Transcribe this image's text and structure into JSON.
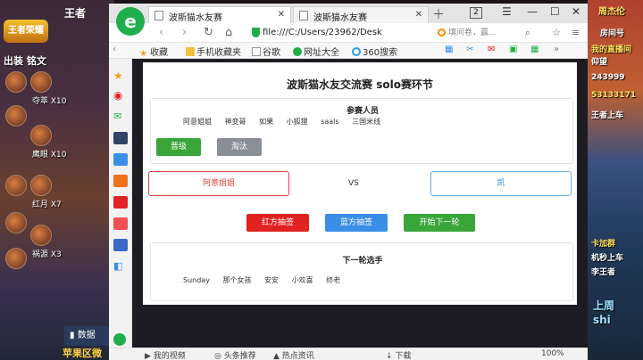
{
  "stream": {
    "logo": "王者",
    "hero_logo": "王者荣耀",
    "section_left": "出装  铭文",
    "skills": [
      {
        "label": "夺萃 X10"
      },
      {
        "label": "鹰眼 X10"
      },
      {
        "label": "红月 X7"
      },
      {
        "label": "祸源 X3"
      }
    ],
    "stats_label": "数据",
    "bottom_left_text": "苹果区微",
    "right_ads": [
      "周杰伦",
      "房间号",
      "我的直播间",
      "仰望",
      "243999",
      "53133171",
      "王者上车",
      "卡加群",
      "机秒上车",
      "李王者",
      "上周",
      "shi"
    ],
    "accent_green": "#1fae4b"
  },
  "browser": {
    "tabs": [
      {
        "label": "波斯猫水友赛"
      },
      {
        "label": "波斯猫水友赛"
      }
    ],
    "tab_count": "2",
    "url": "file:///C:/Users/23962/Desk",
    "search_placeholder": "填问卷，赢...",
    "bookmarks": [
      {
        "label": "收藏"
      },
      {
        "label": "手机收藏夹"
      },
      {
        "label": "谷歌"
      },
      {
        "label": "网址大全"
      },
      {
        "label": "360搜索"
      }
    ],
    "status": [
      {
        "label": "我的视频"
      },
      {
        "label": "头条推荐"
      },
      {
        "label": "热点资讯"
      },
      {
        "label": "下载"
      },
      {
        "label": "100%"
      }
    ]
  },
  "page": {
    "title": "波斯猫水友交流赛 solo赛环节",
    "participants_title": "参赛人员",
    "participants": [
      "阿意姐姐",
      "神变哥",
      "如果",
      "小狐狸",
      "saals",
      "三国米线"
    ],
    "promote_label": "晋级",
    "eliminate_label": "淘汰",
    "red_player": "阿意姐姐",
    "vs": "VS",
    "blue_player": "凯",
    "red_draw_label": "红方抽签",
    "blue_draw_label": "蓝方抽签",
    "next_round_label": "开始下一轮",
    "next_title": "下一轮选手",
    "next_players": [
      "Sunday",
      "那个女孩",
      "安安",
      "小欢喜",
      "终老"
    ],
    "colors": {
      "red": "#e02222",
      "blue": "#3a8ee6",
      "green": "#3aa63a",
      "gray": "#8a8f96",
      "promote": "#3aa63a"
    }
  }
}
